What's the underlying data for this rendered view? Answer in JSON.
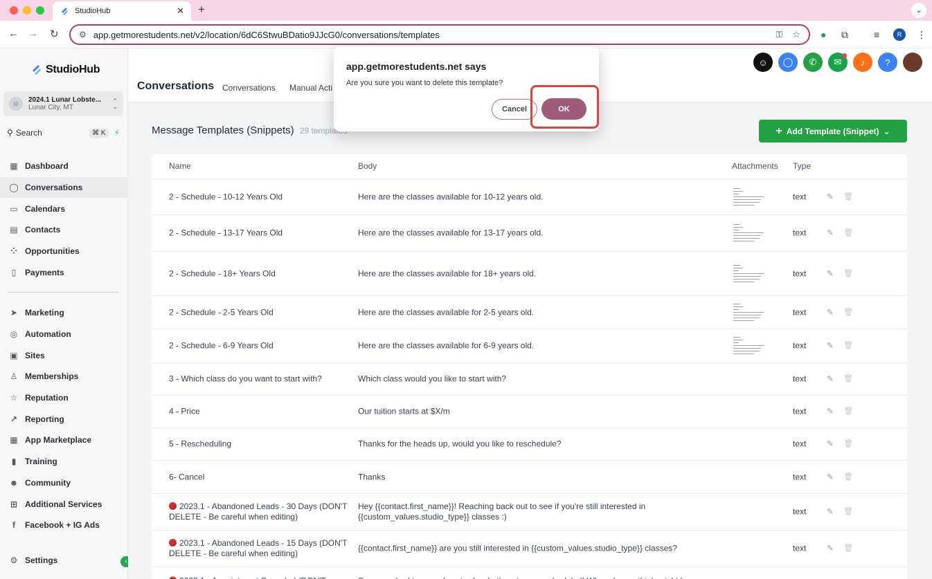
{
  "browser": {
    "tab_title": "StudioHub",
    "url": "app.getmorestudents.net/v2/location/6dC6StwuBDatio9JJcG0/conversations/templates",
    "profile_initial": "R"
  },
  "sidebar": {
    "brand": "StudioHub",
    "location_name": "2024.1 Lunar Lobste...",
    "location_city": "Lunar City, MT",
    "search_label": "Search",
    "search_shortcut": "⌘ K",
    "items_top": [
      {
        "label": "Dashboard",
        "icon": "dashboard-icon",
        "glyph": "▦"
      },
      {
        "label": "Conversations",
        "icon": "chat-icon",
        "glyph": "◯"
      },
      {
        "label": "Calendars",
        "icon": "calendar-icon",
        "glyph": "▭"
      },
      {
        "label": "Contacts",
        "icon": "contacts-icon",
        "glyph": "▤"
      },
      {
        "label": "Opportunities",
        "icon": "opportunities-icon",
        "glyph": "⁘"
      },
      {
        "label": "Payments",
        "icon": "payments-icon",
        "glyph": "▯"
      }
    ],
    "items_bottom": [
      {
        "label": "Marketing",
        "icon": "send-icon",
        "glyph": "➤"
      },
      {
        "label": "Automation",
        "icon": "automation-icon",
        "glyph": "◎"
      },
      {
        "label": "Sites",
        "icon": "sites-icon",
        "glyph": "▣"
      },
      {
        "label": "Memberships",
        "icon": "membership-icon",
        "glyph": "♙"
      },
      {
        "label": "Reputation",
        "icon": "star-icon",
        "glyph": "☆"
      },
      {
        "label": "Reporting",
        "icon": "trend-icon",
        "glyph": "↗"
      },
      {
        "label": "App Marketplace",
        "icon": "grid-icon",
        "glyph": "▦"
      },
      {
        "label": "Training",
        "icon": "book-icon",
        "glyph": "▮"
      },
      {
        "label": "Community",
        "icon": "community-icon",
        "glyph": "☻"
      },
      {
        "label": "Additional Services",
        "icon": "cart-icon",
        "glyph": "⊞"
      },
      {
        "label": "Facebook + IG Ads",
        "icon": "facebook-icon",
        "glyph": "f"
      }
    ],
    "settings_label": "Settings"
  },
  "header": {
    "title": "Conversations",
    "tabs": [
      "Conversations",
      "Manual Acti"
    ]
  },
  "main": {
    "section_title": "Message Templates (Snippets)",
    "count_text": "29 templates",
    "add_button": "Add Template (Snippet)",
    "columns": [
      "Name",
      "Body",
      "Attachments",
      "Type"
    ],
    "rows": [
      {
        "name": "2 - Schedule - 10-12 Years Old",
        "body": "Here are the classes available for 10-12 years old.",
        "type": "text",
        "attachment": true,
        "red": false
      },
      {
        "name": "2 - Schedule - 13-17 Years Old",
        "body": "Here are the classes available for 13-17 years old.",
        "type": "text",
        "attachment": true,
        "red": false
      },
      {
        "name": "2 - Schedule - 18+ Years Old",
        "body": "Here are the classes available for 18+ years old.",
        "type": "text",
        "attachment": true,
        "red": false
      },
      {
        "name": "2 - Schedule - 2-5 Years Old",
        "body": "Here are the classes available for 2-5 years old.",
        "type": "text",
        "attachment": true,
        "red": false
      },
      {
        "name": "2 - Schedule - 6-9 Years Old",
        "body": "Here are the classes available for 6-9 years old.",
        "type": "text",
        "attachment": true,
        "red": false
      },
      {
        "name": "3 - Which class do you want to start with?",
        "body": "Which class would you like to start with?",
        "type": "text",
        "attachment": false,
        "red": false
      },
      {
        "name": "4 - Price",
        "body": "Our tuition starts at $X/m",
        "type": "text",
        "attachment": false,
        "red": false
      },
      {
        "name": "5 - Rescheduling",
        "body": "Thanks for the heads up, would you like to reschedule?",
        "type": "text",
        "attachment": false,
        "red": false
      },
      {
        "name": "6- Cancel",
        "body": "Thanks",
        "type": "text",
        "attachment": false,
        "red": false
      },
      {
        "name": "2023.1 - Abandoned Leads - 30 Days (DON'T DELETE - Be careful when editing)",
        "body": "Hey {{contact.first_name}}! Reaching back out to see if you're still interested in {{custom_values.studio_type}} classes :)",
        "type": "text",
        "attachment": false,
        "red": true
      },
      {
        "name": "2023.1 - Abandoned Leads - 15 Days (DON'T DELETE - Be careful when editing)",
        "body": "{{contact.first_name}} are you still interested in {{custom_values.studio_type}} classes?",
        "type": "text",
        "attachment": false,
        "red": true
      },
      {
        "name": "2023.1 - Appointment Canceled (DON'T",
        "body": "Sorry you had to cancel yesterday. Let's get you rescheduled! When do you think might be a",
        "type": "",
        "attachment": false,
        "red": true
      }
    ]
  },
  "dialog": {
    "title": "app.getmorestudents.net says",
    "message": "Are you sure you want to delete this template?",
    "cancel": "Cancel",
    "ok": "OK"
  },
  "colors": {
    "accent": "#a05a7a",
    "add_button": "#22a142",
    "highlight": "#d9443c"
  }
}
